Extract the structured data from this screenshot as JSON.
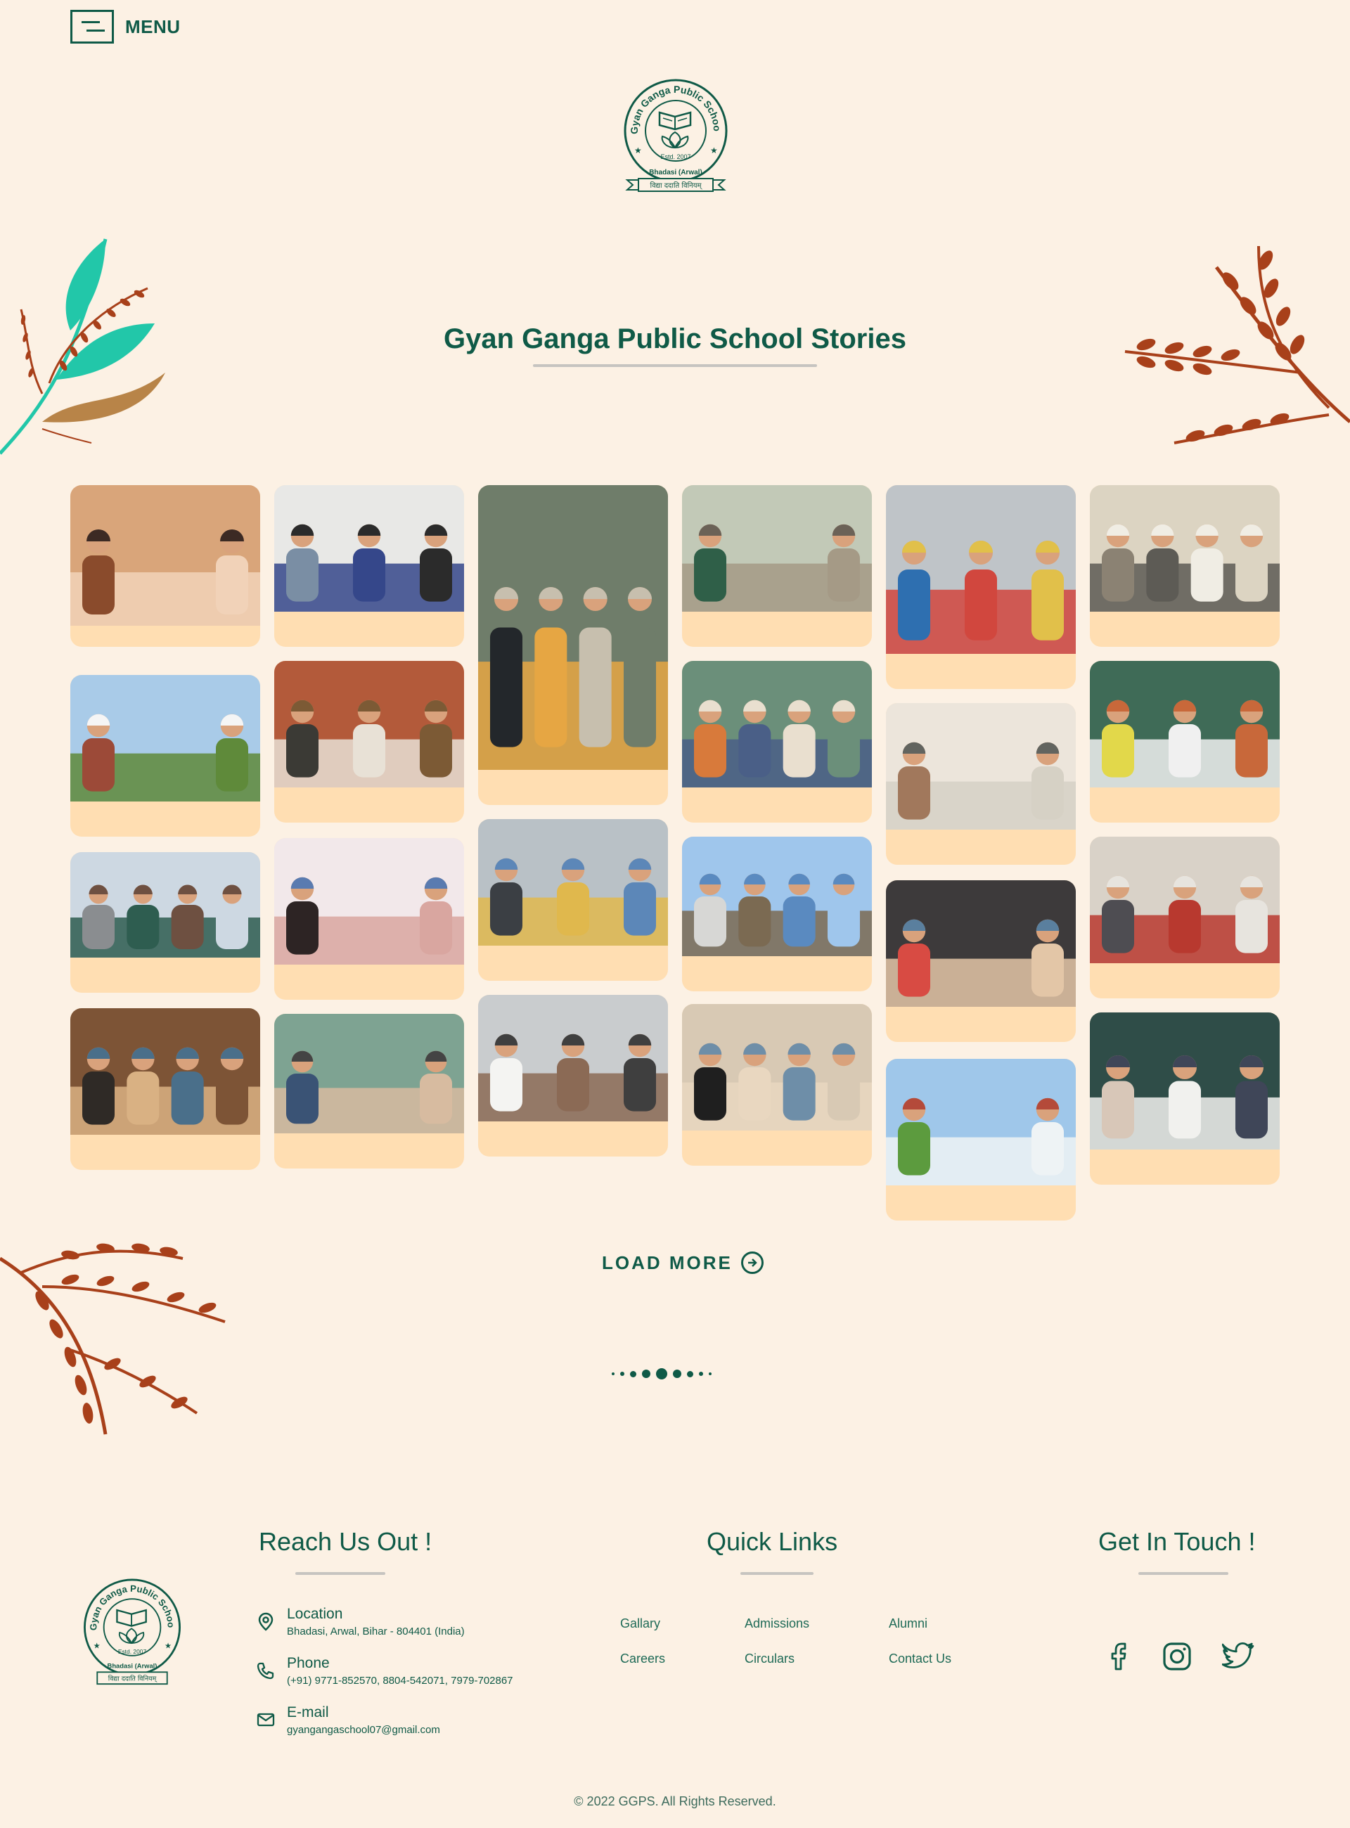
{
  "header": {
    "menu_label": "MENU"
  },
  "logo": {
    "ring_text": "Gyan Ganga Public School",
    "estd": "Estd. 2007",
    "place": "Bhadasi (Arwal)",
    "motto": "विद्या ददाति विनियम्"
  },
  "page": {
    "title": "Gyan Ganga Public School Stories"
  },
  "gallery": {
    "photos": [
      "students-in-lecture-hall",
      "students-at-laptops-classroom",
      "student-with-notebooks",
      "graduate-in-gown",
      "children-with-backpacks",
      "empty-classroom-desks",
      "school-campus-lawn",
      "girl-reading-in-library",
      "boys-in-classroom",
      "children-in-hallway",
      "children-raising-hands",
      "empty-classroom",
      "smiling-student-portrait",
      "teacher-at-computer-lab",
      "school-building-sky",
      "children-in-library-raising-hands",
      "students-with-teacher",
      "boy-reading-in-library",
      "classroom-group-work",
      "student-with-laptop",
      "girl-with-headphones",
      "students-on-field",
      "girls-at-blackboard"
    ]
  },
  "load_more": {
    "label": "LOAD MORE"
  },
  "footer": {
    "reach_title": "Reach Us Out !",
    "quick_title": "Quick Links",
    "touch_title": "Get In Touch !",
    "contacts": [
      {
        "icon": "location-pin-icon",
        "title": "Location",
        "value": "Bhadasi, Arwal, Bihar - 804401 (India)"
      },
      {
        "icon": "phone-icon",
        "title": "Phone",
        "value": "(+91) 9771-852570, 8804-542071, 7979-702867"
      },
      {
        "icon": "mail-icon",
        "title": "E-mail",
        "value": "gyangangaschool07@gmail.com"
      }
    ],
    "links": [
      "Gallary",
      "Admissions",
      "Alumni",
      "Careers",
      "Circulars",
      "Contact Us"
    ],
    "social": [
      "facebook-icon",
      "instagram-icon",
      "twitter-icon"
    ],
    "copyright": "© 2022 GGPS. All Rights Reserved."
  },
  "colors": {
    "background": "#fcf1e4",
    "primary": "#0f5a47",
    "card": "#ffdeb2",
    "leaf_rust": "#a8401a",
    "leaf_teal": "#22c7a9",
    "leaf_tan": "#b88448"
  }
}
